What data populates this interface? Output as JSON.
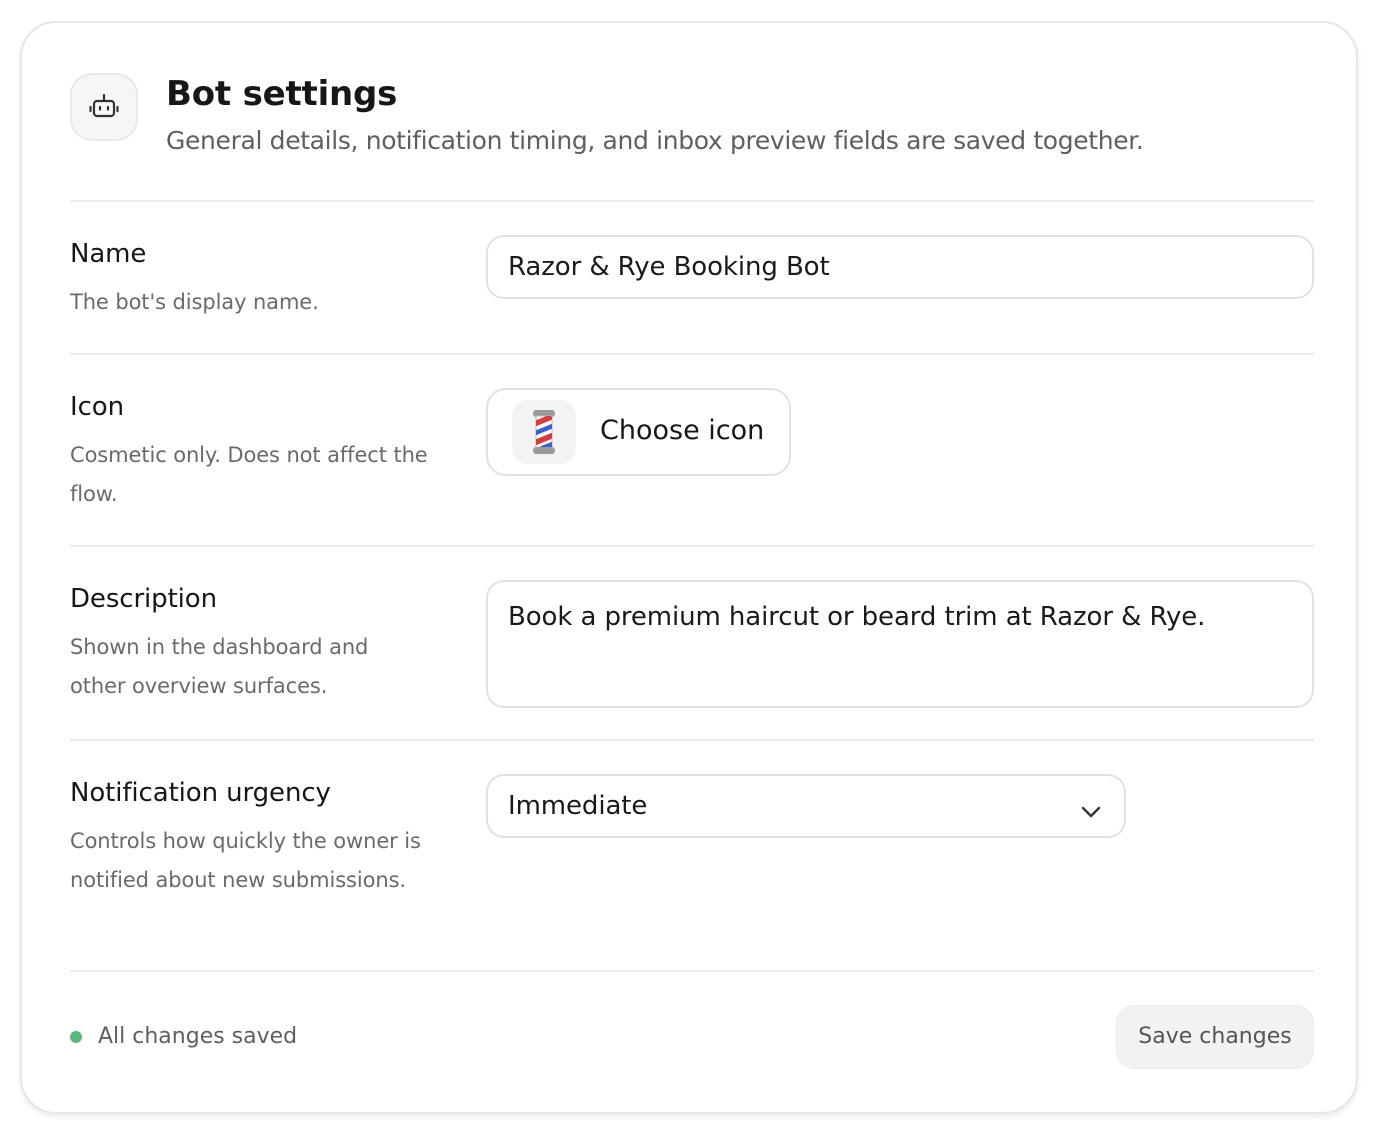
{
  "header": {
    "title": "Bot settings",
    "subtitle": "General details, notification timing, and inbox preview fields are saved together.",
    "icon": "robot-icon"
  },
  "name_row": {
    "label": "Name",
    "help": "The bot's display name.",
    "value": "Razor & Rye Booking Bot"
  },
  "icon_row": {
    "label": "Icon",
    "help": "Cosmetic only. Does not affect the flow.",
    "current_icon": "💈",
    "button_label": "Choose icon"
  },
  "description_row": {
    "label": "Description",
    "help": "Shown in the dashboard and other overview surfaces.",
    "value": "Book a premium haircut or beard trim at Razor & Rye."
  },
  "urgency_row": {
    "label": "Notification urgency",
    "help": "Controls how quickly the owner is notified about new submissions.",
    "selected": "Immediate",
    "chevron_icon": "chevron-down-icon"
  },
  "footer": {
    "status": "All changes saved",
    "status_color": "#5ab67b",
    "save_label": "Save changes"
  }
}
